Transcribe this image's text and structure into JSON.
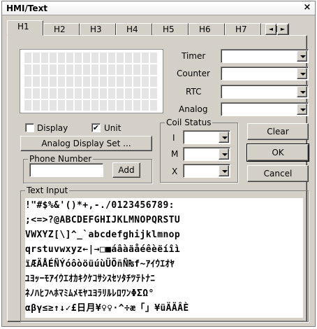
{
  "window": {
    "title": "HMI/Text",
    "close": "×"
  },
  "tabs": [
    "H1",
    "H2",
    "H3",
    "H4",
    "H5",
    "H6",
    "H7",
    "H"
  ],
  "tab_scroll": {
    "left": "◄",
    "right": "►"
  },
  "fields": {
    "timer": "Timer",
    "counter": "Counter",
    "rtc": "RTC",
    "analog": "Analog"
  },
  "checks": {
    "display": {
      "label": "Display",
      "checked": false
    },
    "unit": {
      "label": "Unit",
      "checked": true,
      "mark": "✔"
    }
  },
  "analog_display_set": "Analog Display Set ...",
  "phone": {
    "label": "Phone Number",
    "value": "",
    "add": "Add"
  },
  "coil": {
    "label": "Coil Status",
    "i": "I",
    "m": "M",
    "x": "X"
  },
  "buttons": {
    "clear": "Clear",
    "ok": "OK",
    "cancel": "Cancel"
  },
  "text_input": {
    "label": "Text Input",
    "rows": [
      " !\"#$%&'()*+,-./0123456789:",
      ";<=>?@ABCDEFGHIJKLMNOPQRSTU",
      "VWXYZ[\\]^_`abcdefghijklmnop",
      "qrstuvwxyz←|→□■áâàäåéêèëíîì",
      "ïÆÄÅÉÑÝóôòöüúùÜÖñÑ₨f~ｱｲｳｴｵﾔ",
      "ﾕﾖｯｰﾓｱｲｳｴｵｶｷｸｹｺｻｼｽｾｿﾀﾁﾂﾃﾄﾅﾆ",
      "ﾈﾉﾊﾋﾌﾍﾎﾏﾐﾑﾒﾓﾔﾕﾖﾗﾘﾙﾚﾛﾜﾝΦΣΩ°",
      "αβγ≤≥↑↓✓£日月¥♀♀·^÷æ「」¥üÄÄÂÈ"
    ]
  }
}
